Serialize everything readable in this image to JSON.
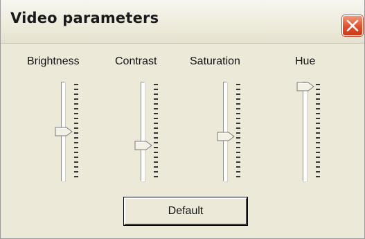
{
  "window": {
    "title": "Video parameters",
    "close_icon": "close-x-icon"
  },
  "sliders": [
    {
      "label": "Brightness",
      "value_fraction": 0.5
    },
    {
      "label": "Contrast",
      "value_fraction": 0.35
    },
    {
      "label": "Saturation",
      "value_fraction": 0.45
    },
    {
      "label": "Hue",
      "value_fraction": 1.0
    }
  ],
  "buttons": {
    "default_label": "Default"
  },
  "colors": {
    "window_bg": "#ece9d8",
    "close_red": "#e0502e"
  }
}
